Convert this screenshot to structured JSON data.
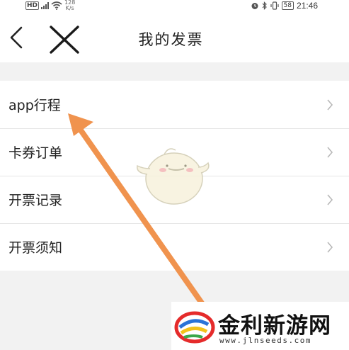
{
  "status_bar": {
    "hd_label": "HD",
    "network_label": "4G",
    "speed_value": "128",
    "speed_unit": "K/s",
    "battery_level": "58",
    "time": "21:46"
  },
  "nav": {
    "title": "我的发票",
    "back_icon": "chevron-left-icon",
    "close_icon": "close-icon"
  },
  "list": {
    "items": [
      {
        "label": "app行程"
      },
      {
        "label": "卡券订单"
      },
      {
        "label": "开票记录"
      },
      {
        "label": "开票须知"
      }
    ],
    "chevron_icon": "chevron-right-icon"
  },
  "annotation": {
    "arrow_color": "#f0934e"
  },
  "watermark": {
    "name": "金利新游网",
    "url": "www.jlnseeds.com"
  },
  "colors": {
    "page_background": "#f2f2f2",
    "list_background": "#ffffff",
    "divider": "#e6e6e6",
    "text": "#222222",
    "chevron": "#b8b8b8"
  }
}
